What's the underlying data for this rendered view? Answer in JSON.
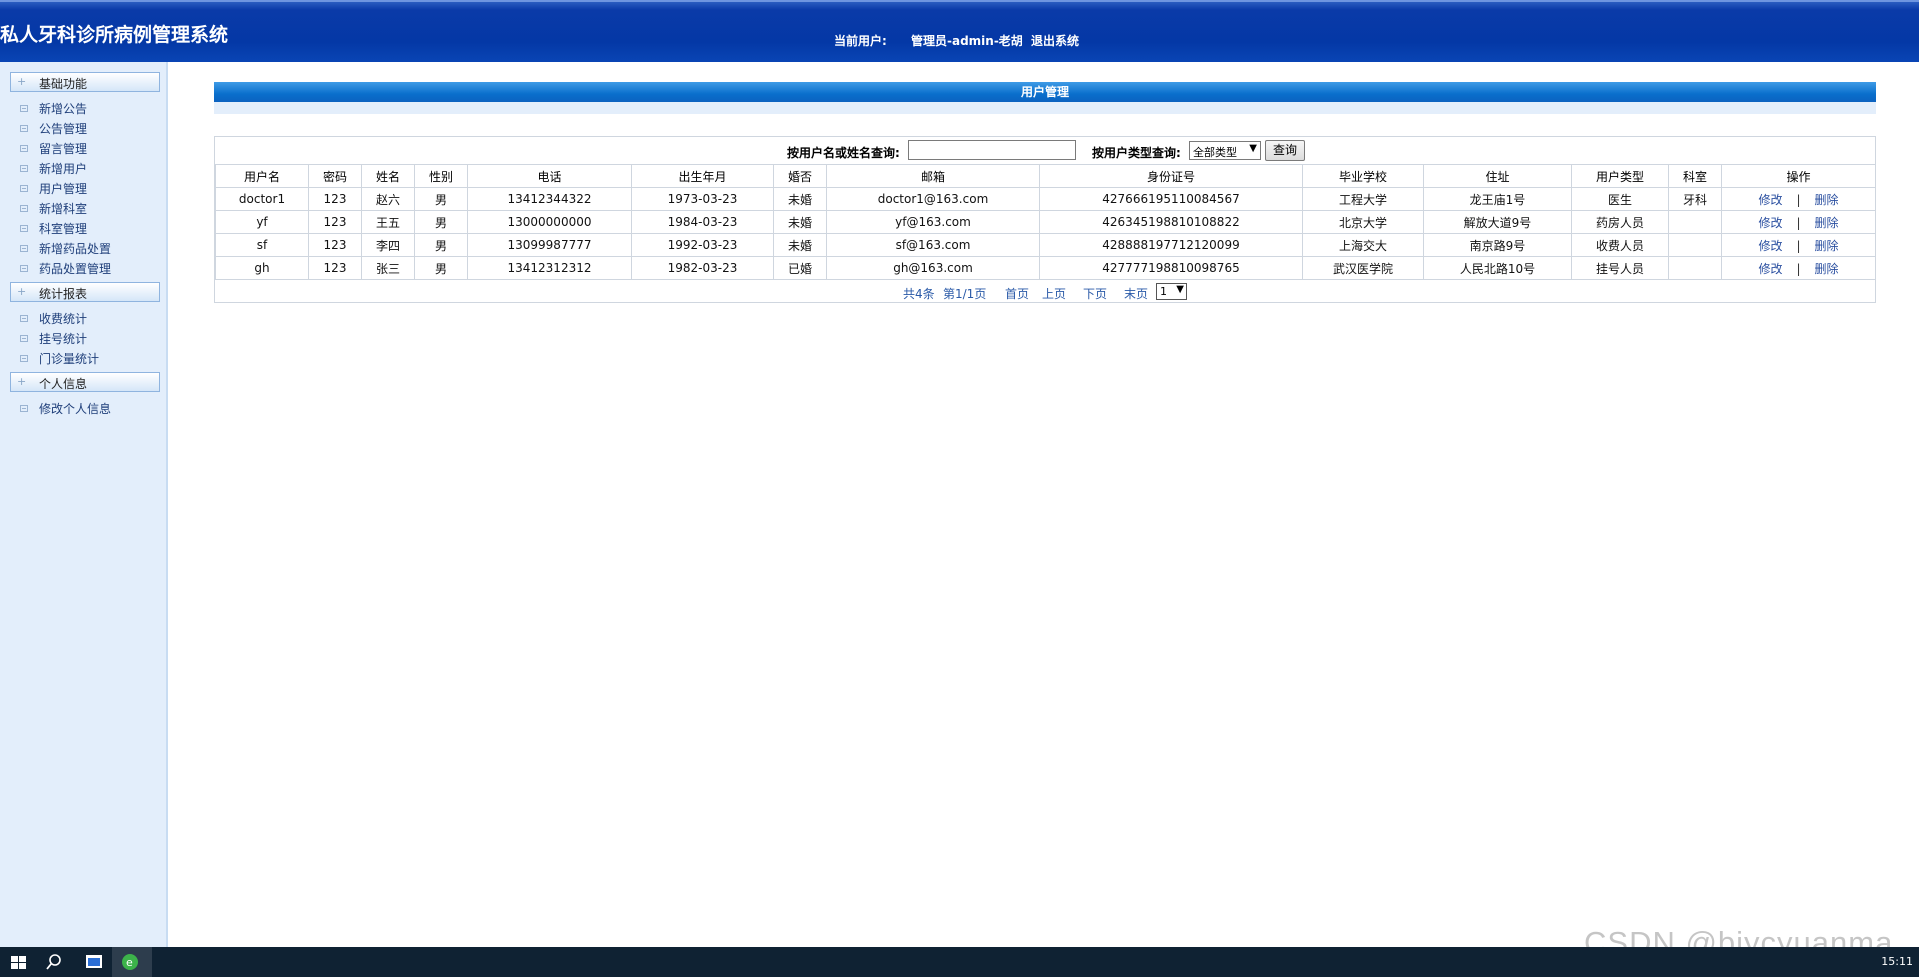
{
  "header": {
    "app_title": "私人牙科诊所病例管理系统",
    "current_user_label": "当前用户:",
    "current_user": "管理员-admin-老胡",
    "logout": "退出系统"
  },
  "sidebar": {
    "groups": [
      {
        "title": "基础功能",
        "items": [
          "新增公告",
          "公告管理",
          "留言管理",
          "新增用户",
          "用户管理",
          "新增科室",
          "科室管理",
          "新增药品处置",
          "药品处置管理"
        ]
      },
      {
        "title": "统计报表",
        "items": [
          "收费统计",
          "挂号统计",
          "门诊量统计"
        ]
      },
      {
        "title": "个人信息",
        "items": [
          "修改个人信息"
        ]
      }
    ]
  },
  "main": {
    "section_title": "用户管理",
    "search": {
      "name_label": "按用户名或姓名查询:",
      "name_value": "",
      "type_label": "按用户类型查询:",
      "type_selected": "全部类型",
      "button": "查询"
    },
    "table": {
      "columns": [
        "用户名",
        "密码",
        "姓名",
        "性别",
        "电话",
        "出生年月",
        "婚否",
        "邮箱",
        "身份证号",
        "毕业学校",
        "住址",
        "用户类型",
        "科室",
        "操作"
      ],
      "rows": [
        [
          "doctor1",
          "123",
          "赵六",
          "男",
          "13412344322",
          "1973-03-23",
          "未婚",
          "doctor1@163.com",
          "427666195110084567",
          "工程大学",
          "龙王庙1号",
          "医生",
          "牙科"
        ],
        [
          "yf",
          "123",
          "王五",
          "男",
          "13000000000",
          "1984-03-23",
          "未婚",
          "yf@163.com",
          "426345198810108822",
          "北京大学",
          "解放大道9号",
          "药房人员",
          ""
        ],
        [
          "sf",
          "123",
          "李四",
          "男",
          "13099987777",
          "1992-03-23",
          "未婚",
          "sf@163.com",
          "428888197712120099",
          "上海交大",
          "南京路9号",
          "收费人员",
          ""
        ],
        [
          "gh",
          "123",
          "张三",
          "男",
          "13412312312",
          "1982-03-23",
          "已婚",
          "gh@163.com",
          "427777198810098765",
          "武汉医学院",
          "人民北路10号",
          "挂号人员",
          ""
        ]
      ],
      "edit_label": "修改",
      "separator": "|",
      "delete_label": "删除"
    },
    "pager": {
      "total": "共4条",
      "page_info": "第1/1页",
      "first": "首页",
      "prev": "上页",
      "next": "下页",
      "last": "末页",
      "page_selected": "1"
    }
  },
  "taskbar": {
    "icons": [
      "windows-start-icon",
      "search-icon",
      "file-explorer-icon",
      "browser-icon"
    ],
    "clock": "15:11"
  },
  "watermark": "CSDN @biycyuanma",
  "colors": {
    "header_blue": "#0438a6",
    "section_bar_blue": "#0a6fcc",
    "sidebar_bg": "#e3eefb",
    "link_blue": "#2a4fa0",
    "taskbar": "#0f2233"
  }
}
